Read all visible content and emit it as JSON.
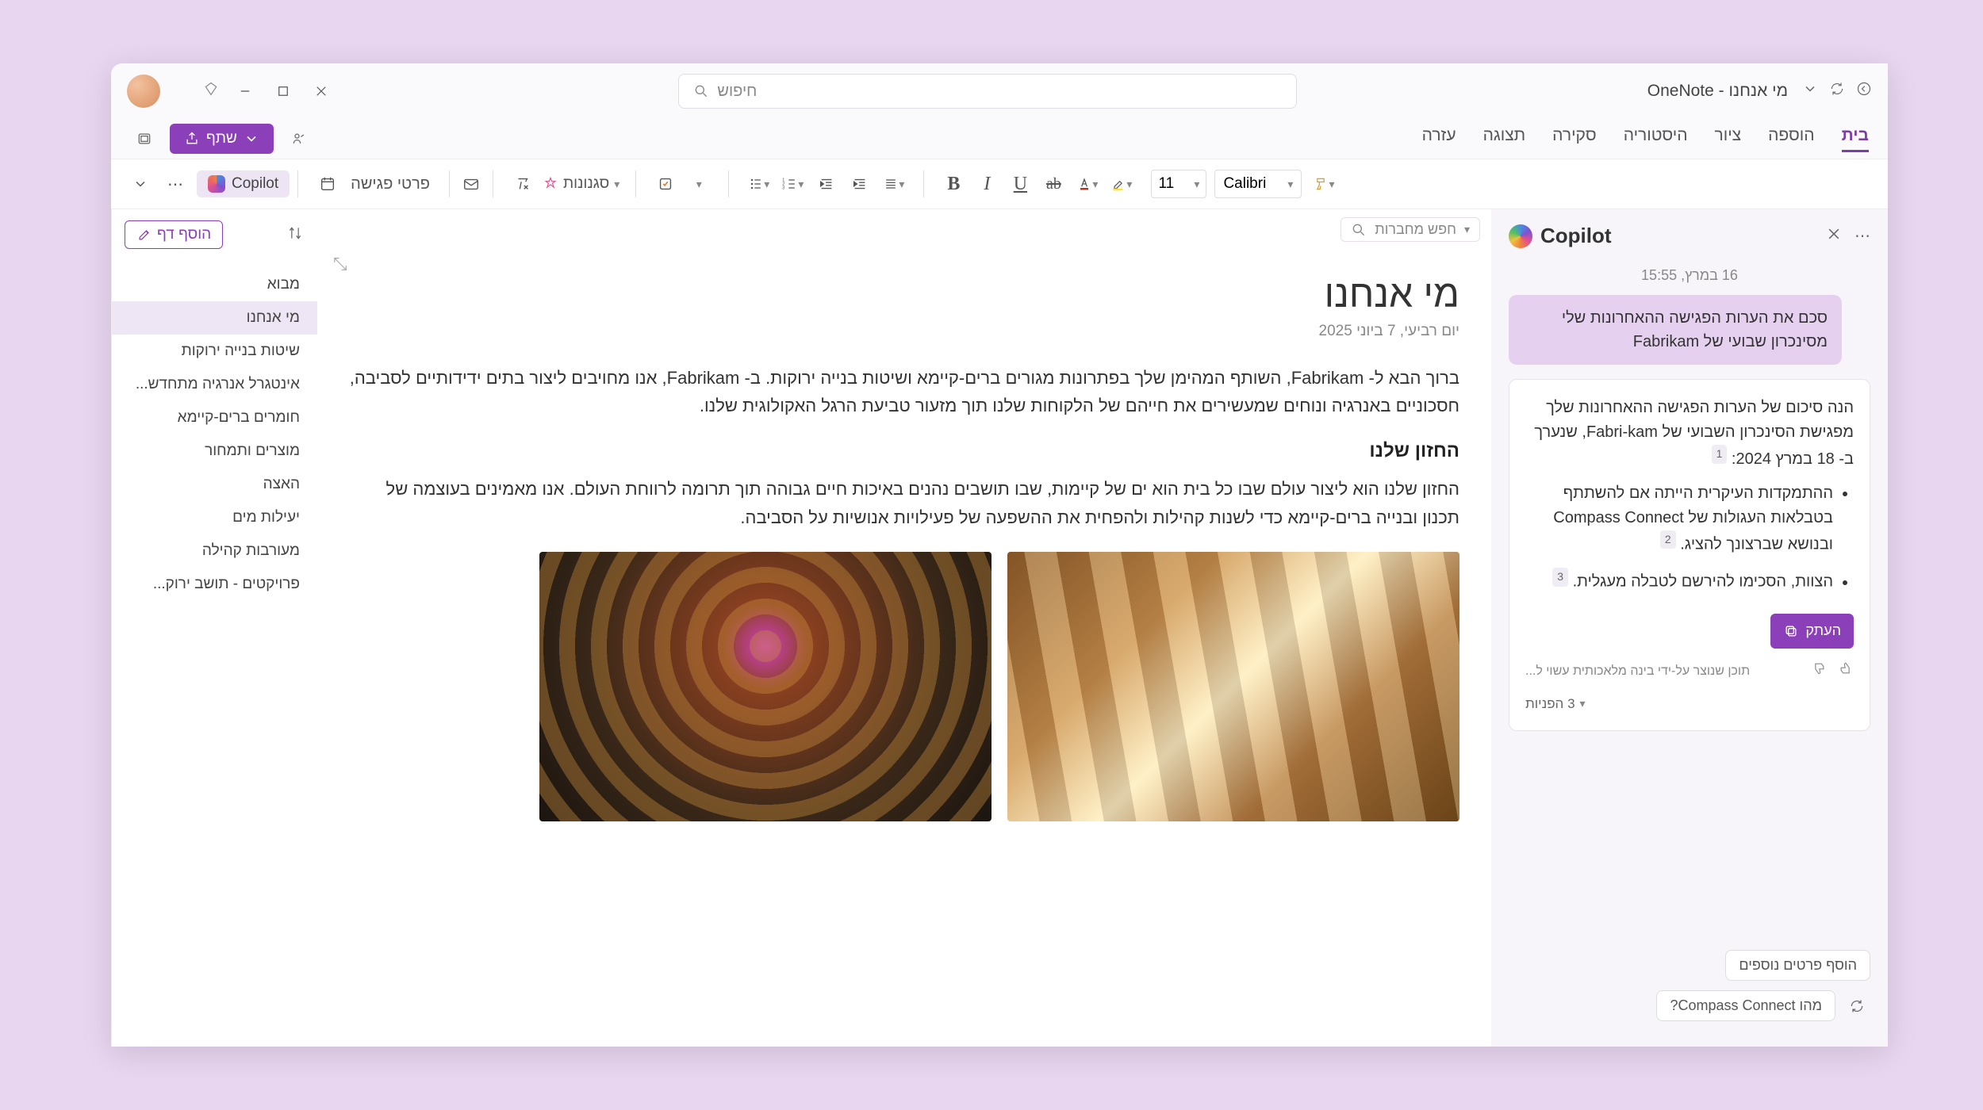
{
  "titlebar": {
    "app_title": "מי אנחנו - OneNote",
    "search_placeholder": "חיפוש"
  },
  "ribbon": {
    "tabs": [
      "בית",
      "הוספה",
      "ציור",
      "היסטוריה",
      "סקירה",
      "תצוגה",
      "עזרה"
    ],
    "share_label": "שתף"
  },
  "toolbar": {
    "font_name": "Calibri",
    "font_size": "11",
    "styles_label": "סגנונות",
    "meeting_label": "פרטי פגישה",
    "copilot_label": "Copilot"
  },
  "notebook_search": {
    "placeholder": "חפש מחברות"
  },
  "page_list": {
    "add_page": "הוסף דף",
    "items": [
      "מבוא",
      "מי אנחנו",
      "שיטות בנייה ירוקות",
      "אינטגרל אנרגיה מתחדש...",
      "חומרים ברים-קיימא",
      "מוצרים ותמחור",
      "האצה",
      "יעילות מים",
      "מעורבות קהילה",
      "פרויקטים - תושב ירוק..."
    ],
    "active_index": 1
  },
  "page": {
    "title": "מי אנחנו",
    "date": "יום רביעי, 7 ביוני 2025",
    "para1": "ברוך הבא ל- Fabrikam, השותף המהימן שלך בפתרונות מגורים ברים-קיימא ושיטות בנייה ירוקות. ב- Fabrikam, אנו מחויבים ליצור בתים ידידותיים לסביבה, חסכוניים באנרגיה ונוחים שמעשירים את חייהם של הלקוחות שלנו תוך מזעור טביעת הרגל האקולוגית שלנו.",
    "h2": "החזון שלנו",
    "para2": "החזון שלנו הוא ליצור עולם שבו כל בית הוא ים של קיימות, שבו תושבים נהנים באיכות חיים גבוהה תוך תרומה לרווחת העולם. אנו מאמינים בעוצמה של תכנון ובנייה ברים-קיימא כדי לשנות קהילות ולהפחית את ההשפעה של פעילויות אנושיות על הסביבה."
  },
  "copilot": {
    "title": "Copilot",
    "timestamp": "16 במרץ, 15:55",
    "user_msg": "סכם את הערות הפגישה ההאחרונות שלי מסינכרון שבועי של Fabrikam",
    "response_intro": "הנה סיכום של הערות הפגישה ההאחרונות שלך מפגישת הסינכרון השבועי של Fabri-kam, שנערך ב- 18 במרץ 2024:",
    "bullet1": "ההתמקדות העיקרית הייתה אם להשתתף בטבלאות העגולות של Compass Connect ובנושא שברצונך להציג.",
    "bullet2": "הצוות, הסכימו להירשם לטבלה מעגלית.",
    "copy_label": "העתק",
    "ai_disclaimer": "תוכן שנוצר על-ידי בינה מלאכותית עשוי ל...",
    "refs_label": "3 הפניות",
    "chip_suggestion": "מהו Compass Connect?",
    "chip_more": "הוסף פרטים נוספים"
  }
}
